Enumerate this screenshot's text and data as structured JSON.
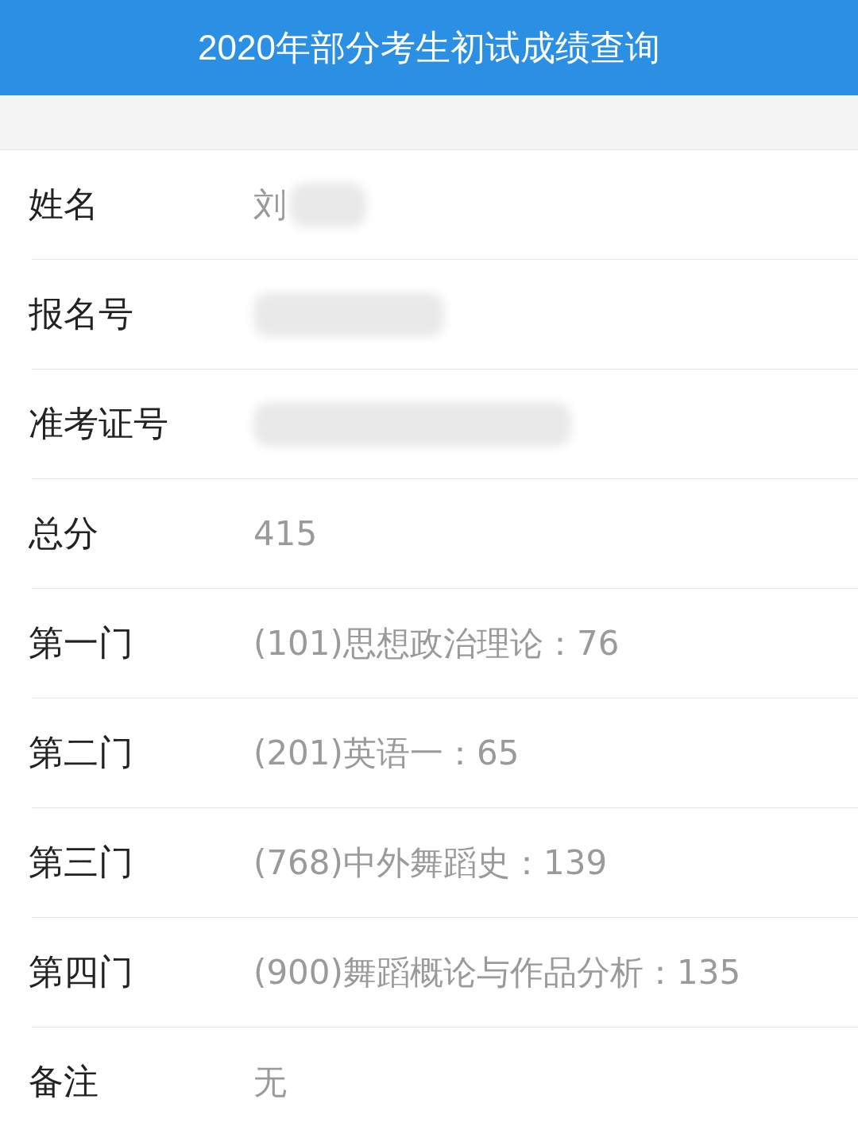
{
  "header": {
    "title": "2020年部分考生初试成绩查询"
  },
  "rows": [
    {
      "label": "姓名",
      "value": "刘",
      "redacted": true
    },
    {
      "label": "报名号",
      "redacted": true
    },
    {
      "label": "准考证号",
      "redacted": true
    },
    {
      "label": "总分",
      "value": "415"
    },
    {
      "label": "第一门",
      "value": "(101)思想政治理论：76"
    },
    {
      "label": "第二门",
      "value": "(201)英语一：65"
    },
    {
      "label": "第三门",
      "value": "(768)中外舞蹈史：139"
    },
    {
      "label": "第四门",
      "value": "(900)舞蹈概论与作品分析：135"
    },
    {
      "label": "备注",
      "value": "无"
    }
  ]
}
